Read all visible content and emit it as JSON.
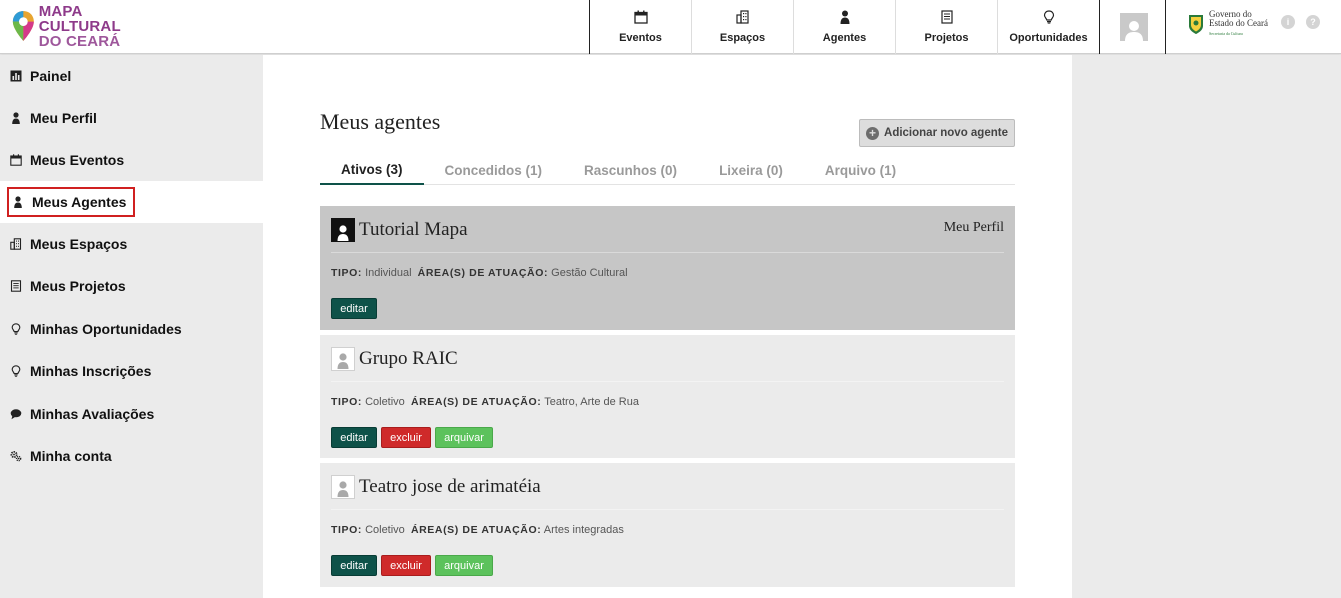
{
  "header": {
    "logo": {
      "line1": "MAPA CULTURAL",
      "line2": "DO CEARÁ"
    },
    "nav": [
      {
        "label": "Eventos",
        "icon": "calendar-icon"
      },
      {
        "label": "Espaços",
        "icon": "building-icon"
      },
      {
        "label": "Agentes",
        "icon": "person-icon"
      },
      {
        "label": "Projetos",
        "icon": "document-icon"
      },
      {
        "label": "Oportunidades",
        "icon": "lightbulb-icon"
      }
    ],
    "gov": {
      "line1": "Governo do",
      "line2": "Estado do Ceará",
      "sub": "Secretaria da Cultura"
    },
    "info_icon": "i",
    "help_icon": "?"
  },
  "sidebar": {
    "items": [
      {
        "label": "Painel",
        "icon": "chart-icon"
      },
      {
        "label": "Meu Perfil",
        "icon": "person-icon"
      },
      {
        "label": "Meus Eventos",
        "icon": "calendar-icon"
      },
      {
        "label": "Meus Agentes",
        "icon": "person-icon"
      },
      {
        "label": "Meus Espaços",
        "icon": "building-icon"
      },
      {
        "label": "Meus Projetos",
        "icon": "document-icon"
      },
      {
        "label": "Minhas Oportunidades",
        "icon": "lightbulb-icon"
      },
      {
        "label": "Minhas Inscrições",
        "icon": "lightbulb-icon"
      },
      {
        "label": "Minhas Avaliações",
        "icon": "chat-icon"
      },
      {
        "label": "Minha conta",
        "icon": "gears-icon"
      }
    ],
    "active_index": 3
  },
  "main": {
    "title": "Meus agentes",
    "add_button": "Adicionar novo agente",
    "tabs": [
      {
        "label": "Ativos (3)"
      },
      {
        "label": "Concedidos (1)"
      },
      {
        "label": "Rascunhos (0)"
      },
      {
        "label": "Lixeira (0)"
      },
      {
        "label": "Arquivo (1)"
      }
    ],
    "labels": {
      "tipo": "TIPO:",
      "area": "ÁREA(S) DE ATUAÇÃO:",
      "edit": "editar",
      "delete": "excluir",
      "archive": "arquivar"
    },
    "agents": [
      {
        "name": "Tutorial Mapa",
        "tag": "Meu Perfil",
        "tipo": "Individual",
        "area": "Gestão Cultural"
      },
      {
        "name": "Grupo RAIC",
        "tag": "",
        "tipo": "Coletivo",
        "area": "Teatro, Arte de Rua"
      },
      {
        "name": "Teatro jose de arimatéia",
        "tag": "",
        "tipo": "Coletivo",
        "area": "Artes integradas"
      }
    ]
  },
  "colors": {
    "brand": "#8e3a8a",
    "edit": "#0e5249",
    "delete": "#cf2a2a",
    "archive": "#5cc25c",
    "highlight": "#d02020"
  }
}
